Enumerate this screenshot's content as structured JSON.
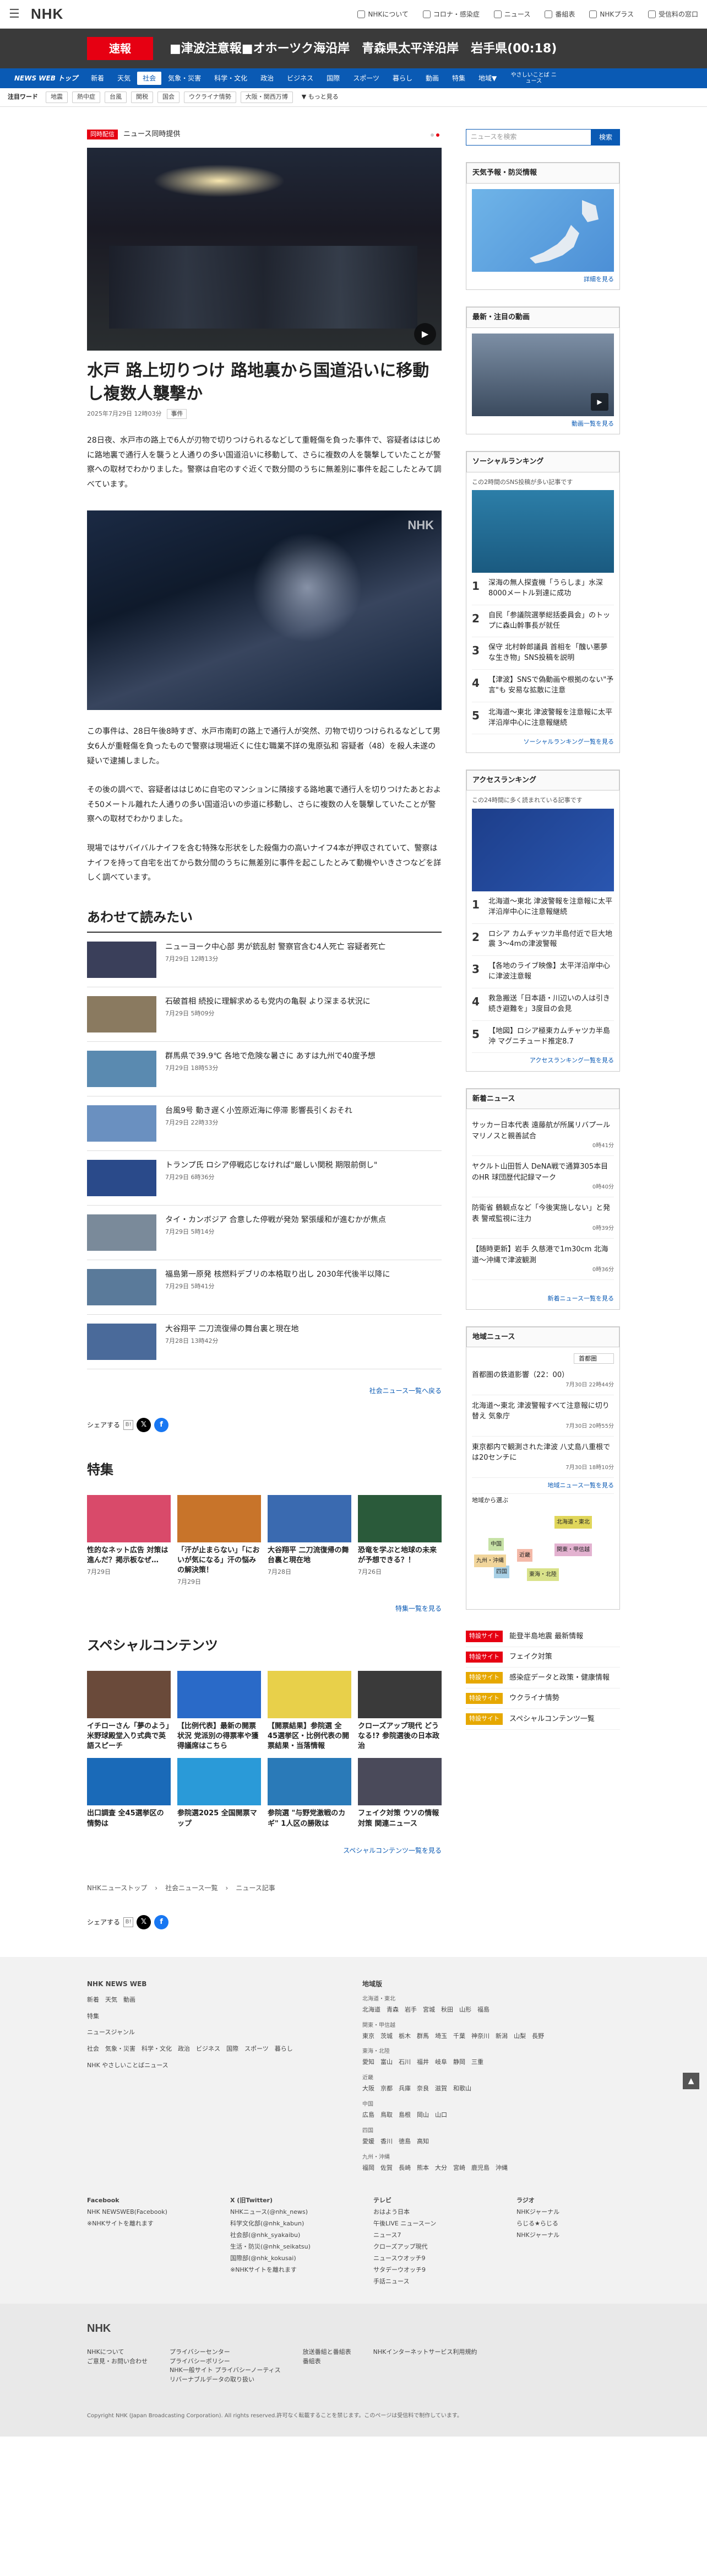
{
  "header": {
    "menu_icon": "hamburger-icon",
    "logo": "NHK",
    "links": [
      "NHKについて",
      "コロナ・感染症",
      "ニュース",
      "番組表",
      "NHKプラス",
      "受信料の窓口"
    ]
  },
  "alert": {
    "badge": "速報",
    "text": "■津波注意報■オホーツク海沿岸　青森県太平洋沿岸　岩手県(00:18)"
  },
  "nav": {
    "items": [
      "NEWS WEB トップ",
      "新着",
      "天気",
      "社会",
      "気象・災害",
      "科学・文化",
      "政治",
      "ビジネス",
      "国際",
      "スポーツ",
      "暮らし",
      "動画",
      "特集",
      "地域▼",
      "やさしいことば ニュース"
    ],
    "active_index": 3
  },
  "trend": {
    "label": "注目ワード",
    "keywords": [
      "地震",
      "熱中症",
      "台風",
      "関税",
      "国会",
      "ウクライナ情勢",
      "大阪・関西万博"
    ],
    "more": "▼ もっと見る"
  },
  "article": {
    "tag": "同時配信",
    "tag_label": "ニュース同時提供",
    "title": "水戸 路上切りつけ 路地裏から国道沿いに移動し複数人襲撃か",
    "date": "2025年7月29日 12時03分",
    "category": "事件",
    "p1": "28日夜、水戸市の路上で6人が刃物で切りつけられるなどして重軽傷を負った事件で、容疑者ははじめに路地裏で通行人を襲うと人通りの多い国道沿いに移動して、さらに複数の人を襲撃していたことが警察への取材でわかりました。警察は自宅のすぐ近くで数分間のうちに無差別に事件を起こしたとみて調べています。",
    "p2": "この事件は、28日午後8時すぎ、水戸市南町の路上で通行人が突然、刃物で切りつけられるなどして男女6人が重軽傷を負ったもので警察は現場近くに住む職業不詳の鬼原弘和 容疑者（48）を殺人未遂の疑いで逮捕しました。",
    "p3": "その後の調べで、容疑者ははじめに自宅のマンションに隣接する路地裏で通行人を切りつけたあとおよそ50メートル離れた人通りの多い国道沿いの歩道に移動し、さらに複数の人を襲撃していたことが警察への取材でわかりました。",
    "p4": "現場ではサバイバルナイフを含む特殊な形状をした殺傷力の高いナイフ4本が押収されていて、警察はナイフを持って自宅を出てから数分間のうちに無差別に事件を起こしたとみて動機やいきさつなどを詳しく調べています。",
    "photo_logo": "NHK"
  },
  "related": {
    "heading": "あわせて読みたい",
    "items": [
      {
        "title": "ニューヨーク中心部 男が銃乱射 警察官含む4人死亡 容疑者死亡",
        "date": "7月29日 12時13分"
      },
      {
        "title": "石破首相 続投に理解求めるも党内の亀裂 より深まる状況に",
        "date": "7月29日 5時09分"
      },
      {
        "title": "群馬県で39.9℃ 各地で危険な暑さに あすは九州で40度予想",
        "date": "7月29日 18時53分"
      },
      {
        "title": "台風9号 動き遅く小笠原近海に停滞 影響長引くおそれ",
        "date": "7月29日 22時33分"
      },
      {
        "title": "トランプ氏 ロシア停戦応じなければ\"厳しい関税 期限前倒し\"",
        "date": "7月29日 6時36分"
      },
      {
        "title": "タイ・カンボジア 合意した停戦が発効 緊張緩和が進むかが焦点",
        "date": "7月29日 5時14分"
      },
      {
        "title": "福島第一原発 核燃料デブリの本格取り出し 2030年代後半以降に",
        "date": "7月29日 5時41分"
      },
      {
        "title": "大谷翔平 二刀流復帰の舞台裏と現在地",
        "date": "7月28日 13時42分"
      }
    ],
    "more": "社会ニュース一覧へ戻る"
  },
  "share": {
    "label": "シェアする"
  },
  "feature": {
    "heading": "特集",
    "items": [
      {
        "title": "性的なネット広告 対策は進んだ？掲示板なぜ…",
        "date": "7月29日"
      },
      {
        "title": "「汗が止まらない」「においが気になる」汗の悩みの解決策！",
        "date": "7月29日"
      },
      {
        "title": "大谷翔平 二刀流復帰の舞台裏と現在地",
        "date": "7月28日"
      },
      {
        "title": "恐竜を学ぶと地球の未来が予想できる？！",
        "date": "7月26日"
      }
    ],
    "more": "特集一覧を見る"
  },
  "special": {
    "heading": "スペシャルコンテンツ",
    "items": [
      {
        "title": "イチローさん「夢のよう」米野球殿堂入り式典で英語スピーチ"
      },
      {
        "title": "【比例代表】最新の開票状況 党派別の得票率や獲得議席はこちら"
      },
      {
        "title": "【開票結果】参院選 全45選挙区・比例代表の開票結果・当落情報"
      },
      {
        "title": "クローズアップ現代 どうなる!? 参院選後の日本政治"
      },
      {
        "title": "出口調査 全45選挙区の情勢は"
      },
      {
        "title": "参院選2025 全国開票マップ"
      },
      {
        "title": "参院選 \"与野党激戦のカギ\" 1人区の勝敗は"
      },
      {
        "title": "フェイク対策 ウソの情報対策 関連ニュース"
      }
    ],
    "more": "スペシャルコンテンツ一覧を見る"
  },
  "breadcrumb": [
    "NHKニューストップ",
    "社会ニュース一覧",
    "ニュース記事"
  ],
  "sidebar": {
    "search_placeholder": "ニュースを検索",
    "search_btn": "検索",
    "weather": {
      "heading": "天気予報・防災情報",
      "more": "詳細を見る"
    },
    "video": {
      "heading": "最新・注目の動画",
      "more": "動画一覧を見る"
    },
    "social": {
      "heading": "ソーシャルランキング",
      "sub": "この2時間のSNS投稿が多い記事です",
      "items": [
        "深海の無人探査機「うらしま」水深8000メートル到達に成功",
        "自民「参議院選挙総括委員会」のトップに森山幹事長が就任",
        "保守 北村幹郎議員 首相を「醜い悪夢な生き物」SNS投稿を説明",
        "【津波】SNSで偽動画や根拠のない\"予言\"も 安易な拡散に注意",
        "北海道〜東北 津波警報を注意報に太平洋沿岸中心に注意報継続"
      ],
      "more": "ソーシャルランキング一覧を見る"
    },
    "access": {
      "heading": "アクセスランキング",
      "sub": "この24時間に多く読まれている記事です",
      "items": [
        "北海道〜東北 津波警報を注意報に太平洋沿岸中心に注意報継続",
        "ロシア カムチャツカ半島付近で巨大地震 3〜4mの津波警報",
        "【各地のライブ映像】太平洋沿岸中心に津波注意報",
        "救急搬送「日本語・川辺いの人は引き続き避難を」3度目の会見",
        "【地図】ロシア極東カムチャツカ半島沖 マグニチュード推定8.7"
      ],
      "more": "アクセスランキング一覧を見る"
    },
    "latest": {
      "heading": "新着ニュース",
      "items": [
        {
          "t": "サッカー日本代表 遠藤航が所属リバプール マリノスと親善試合",
          "d": "0時41分"
        },
        {
          "t": "ヤクルト山田哲人 DeNA戦で通算305本目のHR 球団歴代記録マーク",
          "d": "0時40分"
        },
        {
          "t": "防衛省 鶴観点など「今後実施しない」と発表 警戒監視に注力",
          "d": "0時39分"
        },
        {
          "t": "【随時更新】岩手 久慈港で1m30cm 北海道〜沖縄で津波観測",
          "d": "0時36分"
        }
      ],
      "more": "新着ニュース一覧を見る"
    },
    "region": {
      "heading": "地域ニュース",
      "select": "首都圏",
      "items": [
        {
          "t": "首都圏の鉄道影響（22：00）",
          "d": "7月30日 22時44分"
        },
        {
          "t": "北海道〜東北 津波警報すべて注意報に切り替え 気象庁",
          "d": "7月30日 20時55分"
        },
        {
          "t": "東京都内で観測された津波 八丈島八重根では20センチに",
          "d": "7月30日 18時10分"
        }
      ],
      "more": "地域ニュース一覧を見る",
      "map_label": "地域から選ぶ",
      "map_regions": [
        "北海道・東北",
        "関東・甲信越",
        "東海・北陸",
        "近畿",
        "中国",
        "四国",
        "九州・沖縄"
      ]
    },
    "features": [
      {
        "tag": "特設サイト",
        "t": "能登半島地震 最新情報",
        "red": true
      },
      {
        "tag": "特設サイト",
        "t": "フェイク対策",
        "red": true
      },
      {
        "tag": "特設サイト",
        "t": "感染症データと政策・健康情報",
        "red": false
      },
      {
        "tag": "特設サイト",
        "t": "ウクライナ情勢",
        "red": false
      },
      {
        "tag": "特設サイト",
        "t": "スペシャルコンテンツ一覧",
        "red": false
      }
    ]
  },
  "footer": {
    "title": "NHK NEWS WEB",
    "left_rows": [
      "新着　天気　動画",
      "特集",
      "ニュースジャンル",
      "社会　気象・災害　科学・文化　政治　ビジネス　国際　スポーツ　暮らし",
      "NHK やさしいことばニュース"
    ],
    "region_title": "地域版",
    "regions": [
      {
        "h": "北海道・東北",
        "v": "北海道　青森　岩手　宮城　秋田　山形　福島"
      },
      {
        "h": "関東・甲信越",
        "v": "東京　茨城　栃木　群馬　埼玉　千葉　神奈川　新潟　山梨　長野"
      },
      {
        "h": "東海・北陸",
        "v": "愛知　富山　石川　福井　岐阜　静岡　三重"
      },
      {
        "h": "近畿",
        "v": "大阪　京都　兵庫　奈良　滋賀　和歌山"
      },
      {
        "h": "中国",
        "v": "広島　鳥取　島根　岡山　山口"
      },
      {
        "h": "四国",
        "v": "愛媛　香川　徳島　高知"
      },
      {
        "h": "九州・沖縄",
        "v": "福岡　佐賀　長崎　熊本　大分　宮崎　鹿児島　沖縄"
      }
    ],
    "sns": [
      {
        "h": "Facebook",
        "v": "NHK NEWSWEB(Facebook)\n※NHKサイトを離れます"
      },
      {
        "h": "X (旧Twitter)",
        "v": "NHKニュース(@nhk_news)\n科学文化部(@nhk_kabun)\n社会部(@nhk_syakaibu)\n生活・防災(@nhk_seikatsu)\n国際部(@nhk_kokusai)\n※NHKサイトを離れます"
      },
      {
        "h": "テレビ",
        "v": "おはよう日本\n午後LIVE ニュースーン\nニュース7\nクローズアップ現代\nニュースウオッチ9\nサタデーウオッチ9\n手話ニュース"
      },
      {
        "h": "ラジオ",
        "v": "NHKジャーナル\nらじる★らじる\nNHKジャーナル"
      }
    ]
  },
  "bottom": {
    "logo": "NHK",
    "links": [
      "NHKについて\nご意見・お問い合わせ",
      "プライバシーセンター\nプライバシーポリシー\nNHK一般サイト プライバシーノーティス\nリバーナブルデータの取り扱い",
      "放送番組と番組表\n番組表",
      "NHKインターネットサービス利用規約"
    ],
    "copy": "Copyright NHK (Japan Broadcasting Corporation). All rights reserved.許可なく転載することを禁じます。このページは受信料で制作しています。",
    "totop": "▲"
  }
}
